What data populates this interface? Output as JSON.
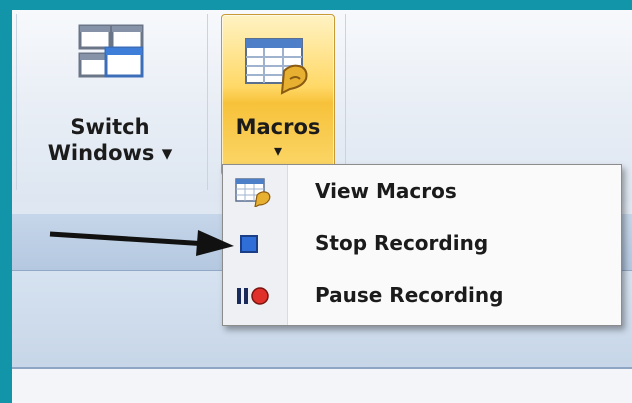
{
  "ribbon": {
    "switch_windows": {
      "line1": "Switch",
      "line2": "Windows ▾"
    },
    "macros": {
      "label": "Macros",
      "arrow": "▾"
    }
  },
  "menu": {
    "items": [
      {
        "label": "View Macros",
        "icon": "view-macros-icon"
      },
      {
        "label": "Stop Recording",
        "icon": "stop-recording-icon"
      },
      {
        "label": "Pause Recording",
        "icon": "pause-recording-icon"
      }
    ]
  },
  "colors": {
    "frame": "#1295a8",
    "macros_button": "#ffd866",
    "stop_icon": "#2f6ed6",
    "record_dot": "#e0302a"
  }
}
